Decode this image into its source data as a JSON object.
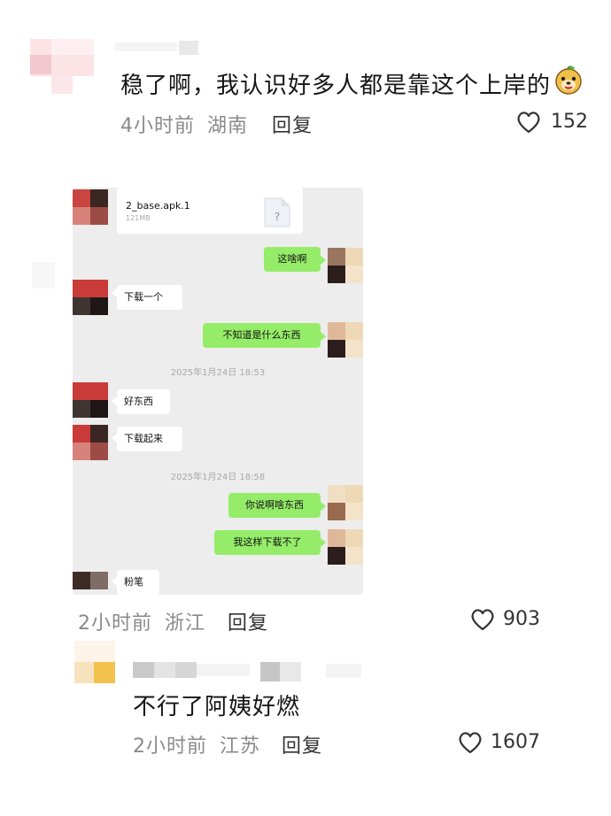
{
  "comments": [
    {
      "text": "稳了啊，我认识好多人都是靠这个上岸的",
      "emoji": "dog-face-emoji",
      "time": "4小时前",
      "location": "湖南",
      "reply_label": "回复",
      "likes": "152"
    },
    {
      "time": "2小时前",
      "location": "浙江",
      "reply_label": "回复",
      "likes": "903"
    },
    {
      "text": "不行了阿姨好燃",
      "time": "2小时前",
      "location": "江苏",
      "reply_label": "回复",
      "likes": "1607"
    }
  ],
  "chat_screenshot": {
    "file": {
      "name": "2_base.apk.1",
      "size": "121MB",
      "icon": "file-unknown-icon"
    },
    "messages": [
      {
        "side": "right",
        "text": "这啥啊"
      },
      {
        "side": "left",
        "text": "下载一个"
      },
      {
        "side": "right",
        "text": "不知道是什么东西"
      },
      {
        "side": "left",
        "text": "好东西"
      },
      {
        "side": "left",
        "text": "下载起来"
      },
      {
        "side": "right",
        "text": "你说啊啥东西"
      },
      {
        "side": "right",
        "text": "我这样下载不了"
      },
      {
        "side": "left",
        "text": "粉笔"
      }
    ],
    "timestamps": [
      "2025年1月24日 18:53",
      "2025年1月24日 18:58"
    ]
  },
  "colors": {
    "bubble_green": "#95ec69",
    "chat_background": "#ededed",
    "meta_gray": "#8a8a8a"
  }
}
